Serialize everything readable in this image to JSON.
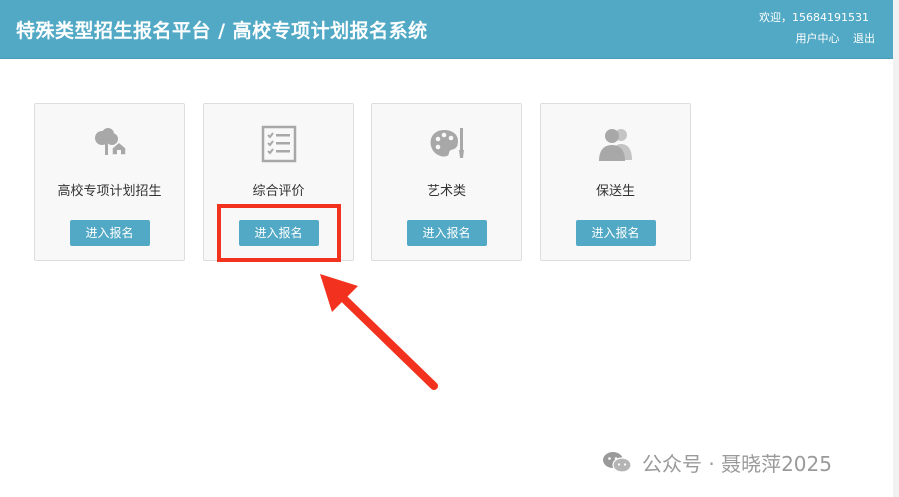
{
  "header": {
    "title": "特殊类型招生报名平台 / 高校专项计划报名系统",
    "welcome": "欢迎，15684191531",
    "user_center": "用户中心",
    "logout": "退出"
  },
  "cards": [
    {
      "label": "高校专项计划招生",
      "icon": "tree-house-icon",
      "button": "进入报名"
    },
    {
      "label": "综合评价",
      "icon": "checklist-icon",
      "button": "进入报名"
    },
    {
      "label": "艺术类",
      "icon": "palette-icon",
      "button": "进入报名"
    },
    {
      "label": "保送生",
      "icon": "users-icon",
      "button": "进入报名"
    }
  ],
  "colors": {
    "header": "#52a9c5",
    "button": "#52a9c5",
    "highlight": "#f2321e",
    "icon": "#a8a8a8"
  },
  "watermark": {
    "text": "公众号 · 聂晓萍2025"
  }
}
